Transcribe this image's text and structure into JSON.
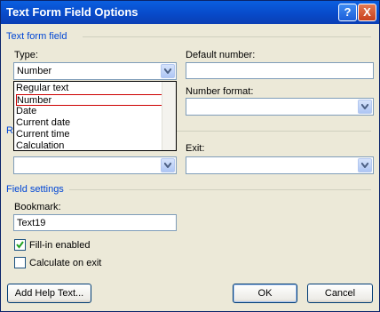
{
  "window": {
    "title": "Text Form Field Options",
    "help_icon": "?",
    "close_icon": "X"
  },
  "text_form_field": {
    "group_label": "Text form field",
    "type_label": "Type:",
    "type_value": "Number",
    "type_options": [
      "Regular text",
      "Number",
      "Date",
      "Current date",
      "Current time",
      "Calculation"
    ],
    "default_label": "Default number:",
    "default_value": "",
    "max_length_value": "",
    "number_format_label": "Number format:",
    "number_format_value": ""
  },
  "run_macro": {
    "group_label_visible": "R",
    "entry_value": "",
    "exit_label": "Exit:",
    "exit_value": ""
  },
  "field_settings": {
    "group_label": "Field settings",
    "bookmark_label": "Bookmark:",
    "bookmark_value": "Text19",
    "fill_in_label": "Fill-in enabled",
    "fill_in_checked": true,
    "calculate_label": "Calculate on exit",
    "calculate_checked": false
  },
  "buttons": {
    "help_text": "Add Help Text...",
    "ok": "OK",
    "cancel": "Cancel"
  }
}
